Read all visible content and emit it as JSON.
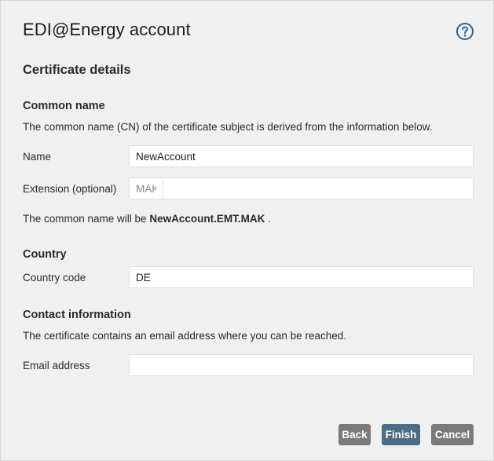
{
  "dialog": {
    "title": "EDI@Energy account",
    "help_icon": "question-circle-icon",
    "section_title": "Certificate details"
  },
  "common_name": {
    "heading": "Common name",
    "description": "The common name (CN) of the certificate subject is derived from the information below.",
    "name_label": "Name",
    "name_value": "NewAccount",
    "extension_label": "Extension (optional)",
    "extension_placeholder": "MAK",
    "extension_value": "",
    "preview_prefix": "The common name will be",
    "preview_value": "NewAccount.EMT.MAK",
    "preview_suffix": "."
  },
  "country": {
    "heading": "Country",
    "code_label": "Country code",
    "code_value": "DE"
  },
  "contact": {
    "heading": "Contact information",
    "description": "The certificate contains an email address where you can be reached.",
    "email_label": "Email address",
    "email_value": ""
  },
  "buttons": {
    "back": "Back",
    "finish": "Finish",
    "cancel": "Cancel"
  },
  "colors": {
    "primary_button": "#4d6d86",
    "secondary_button": "#7a7a7a",
    "help_icon": "#2f5f9a"
  }
}
